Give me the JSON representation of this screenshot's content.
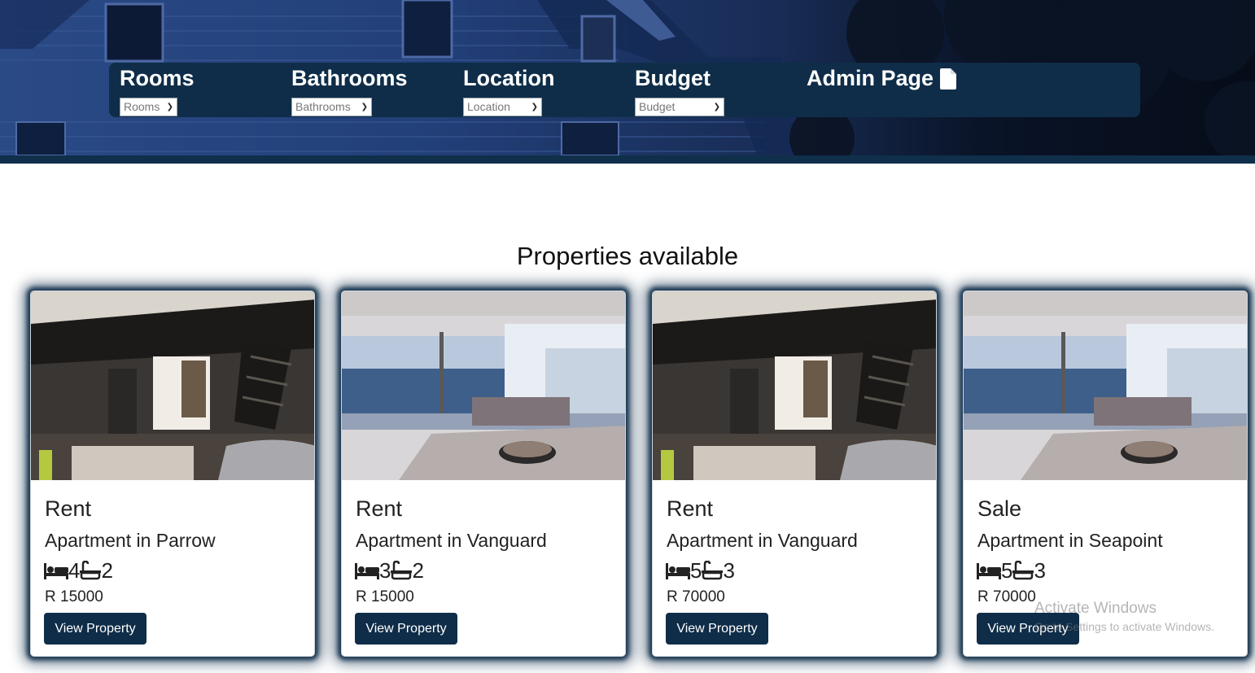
{
  "nav": {
    "filters": [
      {
        "label": "Rooms",
        "placeholder": "Rooms"
      },
      {
        "label": "Bathrooms",
        "placeholder": "Bathrooms"
      },
      {
        "label": "Location",
        "placeholder": "Location"
      },
      {
        "label": "Budget",
        "placeholder": "Budget"
      }
    ],
    "admin_label": "Admin Page",
    "admin_icon": "file-icon"
  },
  "section": {
    "title": "Properties available"
  },
  "properties": [
    {
      "type": "Rent",
      "title": "Apartment in Parrow",
      "bedrooms": "4",
      "bathrooms": "2",
      "price": "R 15000",
      "button": "View Property",
      "image": "loft-living-room"
    },
    {
      "type": "Rent",
      "title": "Apartment in Vanguard",
      "bedrooms": "3",
      "bathrooms": "2",
      "price": "R 15000",
      "button": "View Property",
      "image": "sea-view-apartment"
    },
    {
      "type": "Rent",
      "title": "Apartment in Vanguard",
      "bedrooms": "5",
      "bathrooms": "3",
      "price": "R 70000",
      "button": "View Property",
      "image": "loft-living-room"
    },
    {
      "type": "Sale",
      "title": "Apartment in Seapoint",
      "bedrooms": "5",
      "bathrooms": "3",
      "price": "R 70000",
      "button": "View Property",
      "image": "sea-view-apartment"
    }
  ],
  "watermark": {
    "title": "Activate Windows",
    "subtitle": "Go to Settings to activate Windows."
  },
  "colors": {
    "primary": "#0f2d48",
    "hero_blue": "#223f78",
    "text": "#222222"
  }
}
